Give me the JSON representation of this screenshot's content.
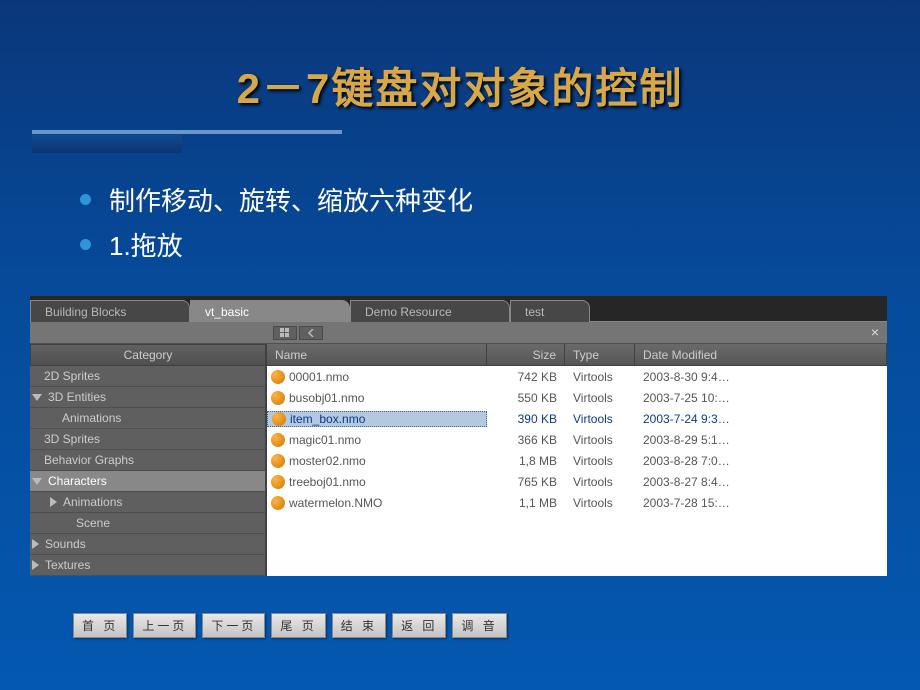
{
  "slide": {
    "title": "2－7键盘对对象的控制",
    "bullets": [
      "制作移动、旋转、缩放六种变化",
      "1.拖放"
    ]
  },
  "tabs": [
    "Building Blocks",
    "vt_basic",
    "Demo Resource",
    "test"
  ],
  "sidebar": {
    "header": "Category",
    "items": [
      {
        "label": "2D Sprites",
        "level": 0
      },
      {
        "label": "3D Entities",
        "level": 0,
        "expanded": true
      },
      {
        "label": "Animations",
        "level": 1
      },
      {
        "label": "3D Sprites",
        "level": 0
      },
      {
        "label": "Behavior Graphs",
        "level": 0
      },
      {
        "label": "Characters",
        "level": 0,
        "expanded": true,
        "selected": true
      },
      {
        "label": "Animations",
        "level": 1,
        "collapsible": true
      },
      {
        "label": "Scene",
        "level": 1
      },
      {
        "label": "Sounds",
        "level": 0,
        "collapsible": true
      },
      {
        "label": "Textures",
        "level": 0,
        "collapsible": true
      }
    ]
  },
  "columns": {
    "name": "Name",
    "size": "Size",
    "type": "Type",
    "date": "Date Modified"
  },
  "files": [
    {
      "name": "00001.nmo",
      "size": "742 KB",
      "type": "Virtools",
      "date": "2003-8-30 9:4…"
    },
    {
      "name": "busobj01.nmo",
      "size": "550 KB",
      "type": "Virtools",
      "date": "2003-7-25 10:…"
    },
    {
      "name": "item_box.nmo",
      "size": "390 KB",
      "type": "Virtools",
      "date": "2003-7-24 9:3…",
      "selected": true
    },
    {
      "name": "magic01.nmo",
      "size": "366 KB",
      "type": "Virtools",
      "date": "2003-8-29 5:1…"
    },
    {
      "name": "moster02.nmo",
      "size": "1,8 MB",
      "type": "Virtools",
      "date": "2003-8-28 7:0…"
    },
    {
      "name": "treeboj01.nmo",
      "size": "765 KB",
      "type": "Virtools",
      "date": "2003-8-27 8:4…"
    },
    {
      "name": "watermelon.NMO",
      "size": "1,1 MB",
      "type": "Virtools",
      "date": "2003-7-28 15:…"
    }
  ],
  "nav": [
    "首 页",
    "上一页",
    "下一页",
    "尾 页",
    "结 束",
    "返 回",
    "调 音"
  ]
}
